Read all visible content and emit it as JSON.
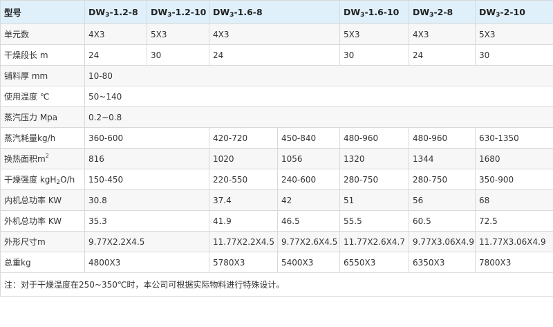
{
  "header": {
    "label": "型号",
    "models": [
      {
        "pre": "DW",
        "sub": "3",
        "post": "-1.2-8"
      },
      {
        "pre": "DW",
        "sub": "3",
        "post": "-1.2-10"
      },
      {
        "pre": "DW",
        "sub": "3",
        "post": "-1.6-8"
      },
      {
        "pre": "DW",
        "sub": "3",
        "post": "-1.6-10"
      },
      {
        "pre": "DW",
        "sub": "3",
        "post": "-2-8"
      },
      {
        "pre": "DW",
        "sub": "3",
        "post": "-2-10"
      }
    ]
  },
  "rows": {
    "units": {
      "label": "单元数",
      "values": [
        "4X3",
        "5X3",
        "4X3",
        "5X3",
        "4X3",
        "5X3"
      ]
    },
    "length": {
      "label": "干燥段长 m",
      "values": [
        "24",
        "30",
        "24",
        "30",
        "24",
        "30"
      ]
    },
    "thickness": {
      "label": "铺料厚 mm",
      "value": "10-80"
    },
    "temp": {
      "label": "使用温度 ℃",
      "value": "50~140"
    },
    "pressure": {
      "label": "蒸汽压力 Mpa",
      "value": "0.2~0.8"
    },
    "steam": {
      "label": "蒸汽耗量kg/h",
      "values": [
        "360-600",
        "420-720",
        "450-840",
        "480-960",
        "480-960",
        "630-1350"
      ]
    },
    "area": {
      "label_pre": "换热面积m",
      "label_sup": "2",
      "values": [
        "816",
        "1020",
        "1056",
        "1320",
        "1344",
        "1680"
      ]
    },
    "intensity": {
      "label_pre": "干燥强度 kgH",
      "label_sub": "2",
      "label_post": "O/h",
      "values": [
        "150-450",
        "220-550",
        "240-600",
        "280-750",
        "280-750",
        "350-900"
      ]
    },
    "inner_power": {
      "label": "内机总功率 KW",
      "values": [
        "30.8",
        "37.4",
        "42",
        "51",
        "56",
        "68"
      ]
    },
    "outer_power": {
      "label": "外机总功率 KW",
      "values": [
        "35.3",
        "41.9",
        "46.5",
        "55.5",
        "60.5",
        "72.5"
      ]
    },
    "size": {
      "label": "外形尺寸m",
      "values": [
        "9.77X2.2X4.5",
        "11.77X2.2X4.5",
        "9.77X2.6X4.5",
        "11.77X2.6X4.7",
        "9.77X3.06X4.9",
        "11.77X3.06X4.9"
      ]
    },
    "weight": {
      "label": "总重kg",
      "values": [
        "4800X3",
        "5780X3",
        "5400X3",
        "6550X3",
        "6350X3",
        "7800X3"
      ]
    }
  },
  "note": "注：对于干燥温度在250~350℃时，本公司可根据实际物料进行特殊设计。"
}
